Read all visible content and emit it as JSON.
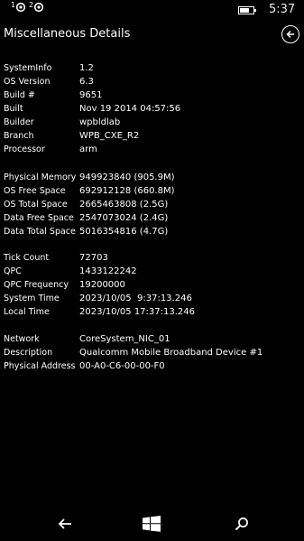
{
  "status_bar": {
    "sim1_label": "1",
    "sim2_label": "2",
    "battery_level": 0.7,
    "time": "5:37"
  },
  "header": {
    "title": "Miscellaneous Details",
    "back_icon": "back-arrow-circle-icon"
  },
  "system": [
    {
      "key": "SystemInfo",
      "value": "1.2"
    },
    {
      "key": "OS Version",
      "value": "6.3"
    },
    {
      "key": "Build #",
      "value": "9651"
    },
    {
      "key": "Built",
      "value": "Nov 19 2014 04:57:56"
    },
    {
      "key": "Builder",
      "value": "wpbldlab"
    },
    {
      "key": "Branch",
      "value": "WPB_CXE_R2"
    },
    {
      "key": "Processor",
      "value": "arm"
    }
  ],
  "storage": [
    {
      "key": "Physical Memory",
      "value": "949923840 (905.9M)"
    },
    {
      "key": "OS Free Space",
      "value": "692912128 (660.8M)"
    },
    {
      "key": "OS Total Space",
      "value": "2665463808 (2.5G)"
    },
    {
      "key": "Data Free Space",
      "value": "2547073024 (2.4G)"
    },
    {
      "key": "Data Total Space",
      "value": "5016354816 (4.7G)"
    }
  ],
  "timing": [
    {
      "key": "Tick Count",
      "value": "72703"
    },
    {
      "key": "QPC",
      "value": "1433122242"
    },
    {
      "key": "QPC Frequency",
      "value": "19200000"
    },
    {
      "key": "System Time",
      "value": "2023/10/05  9:37:13.246"
    },
    {
      "key": "Local Time",
      "value": "2023/10/05 17:37:13.246"
    }
  ],
  "network": [
    {
      "key": "Network",
      "value": "CoreSystem_NIC_01"
    },
    {
      "key": "Description",
      "value": "Qualcomm Mobile Broadband Device #1"
    },
    {
      "key": "Physical Address",
      "value": "00-A0-C6-00-00-F0"
    }
  ],
  "nav_bar": {
    "back_icon": "back-arrow-icon",
    "start_icon": "windows-logo-icon",
    "search_icon": "search-icon"
  }
}
